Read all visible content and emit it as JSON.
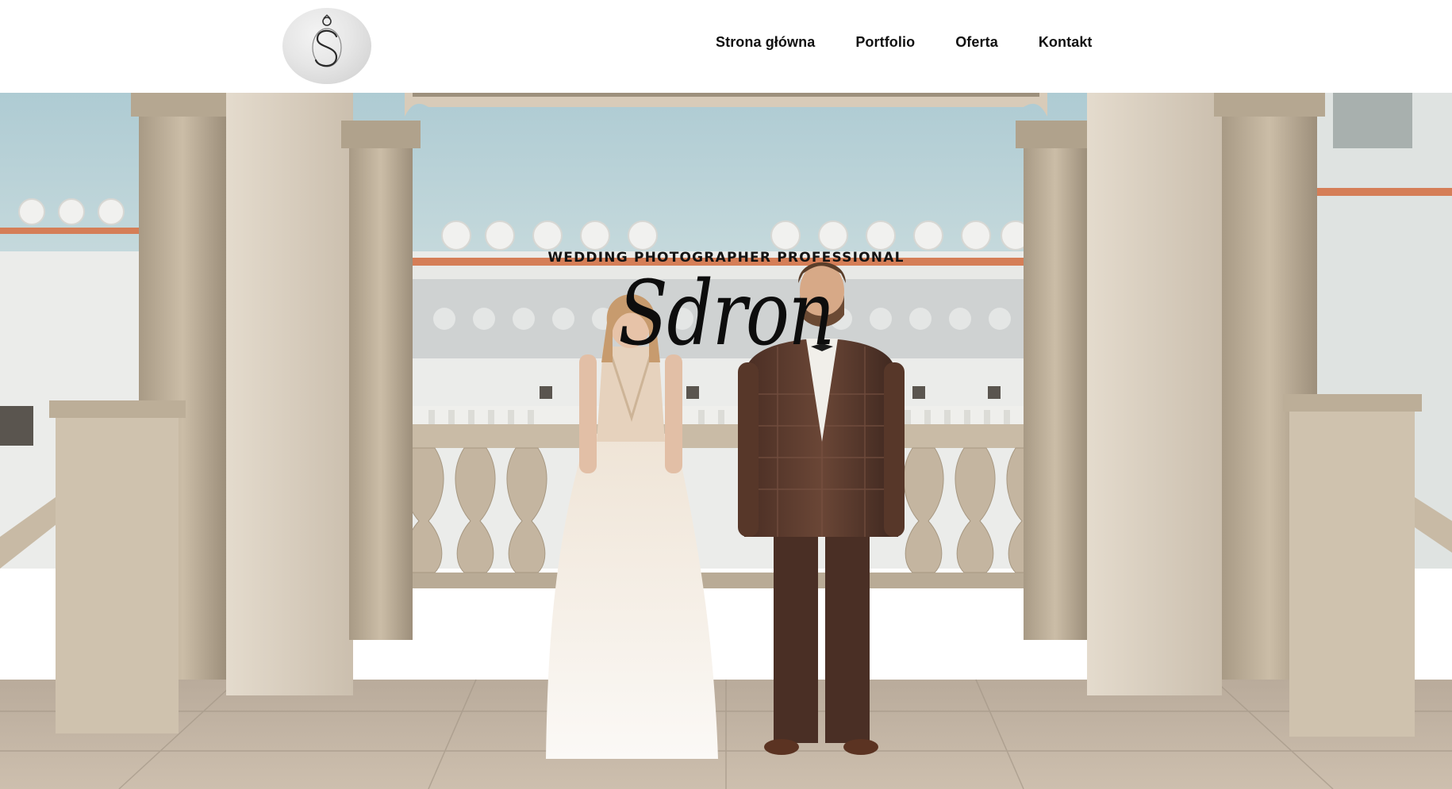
{
  "header": {
    "logo_alt": "S",
    "nav": [
      {
        "label": "Strona główna"
      },
      {
        "label": "Portfolio"
      },
      {
        "label": "Oferta"
      },
      {
        "label": "Kontakt"
      }
    ]
  },
  "hero": {
    "tagline": "WEDDING PHOTOGRAPHER PROFESSIONAL",
    "brand": "Sdron",
    "image_description_icon": "wedding-couple-photo"
  },
  "colors": {
    "stone": "#c9b9a3",
    "sky": "#c9dbe1",
    "text": "#111111"
  }
}
